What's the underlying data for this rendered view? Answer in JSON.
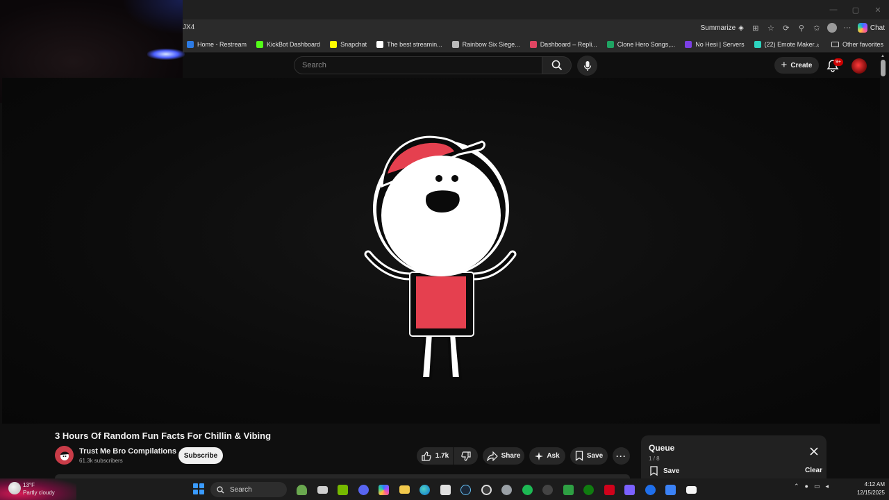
{
  "browser": {
    "url_fragment": "JX4",
    "summarize_label": "Summarize",
    "chat_label": "Chat",
    "bookmarks": [
      {
        "label": "Home - Restream",
        "color": "#2c7be5"
      },
      {
        "label": "KickBot Dashboard",
        "color": "#53fc18"
      },
      {
        "label": "Snapchat",
        "color": "#fffc00"
      },
      {
        "label": "The best streamin...",
        "color": "#ffffff"
      },
      {
        "label": "Rainbow Six Siege...",
        "color": "#bbbbbb"
      },
      {
        "label": "Dashboard – Repli...",
        "color": "#e04562"
      },
      {
        "label": "Clone Hero Songs,...",
        "color": "#1fa463"
      },
      {
        "label": "No Hesi | Servers",
        "color": "#7b3fe4"
      },
      {
        "label": "(22) Emote Maker...",
        "color": "#2dd4bf"
      }
    ],
    "other_favorites": "Other favorites"
  },
  "masthead": {
    "search_placeholder": "Search",
    "create_label": "Create",
    "notification_count": "9+"
  },
  "video": {
    "title": "3 Hours Of Random Fun Facts For Chillin & Vibing",
    "channel_name": "Trust Me Bro Compilations",
    "subscribers": "61.3k subscribers",
    "subscribe_label": "Subscribe",
    "like_count": "1.7k",
    "share_label": "Share",
    "ask_label": "Ask",
    "save_label": "Save"
  },
  "queue": {
    "title": "Queue",
    "position": "1 / 8",
    "save_label": "Save",
    "clear_label": "Clear"
  },
  "taskbar": {
    "temperature": "13°F",
    "weather": "Partly cloudy",
    "search_label": "Search",
    "time": "4:12 AM",
    "date": "12/15/2025"
  },
  "colors": {
    "accent_red": "#e5404f",
    "youtube_bg": "#0f0f0f"
  }
}
